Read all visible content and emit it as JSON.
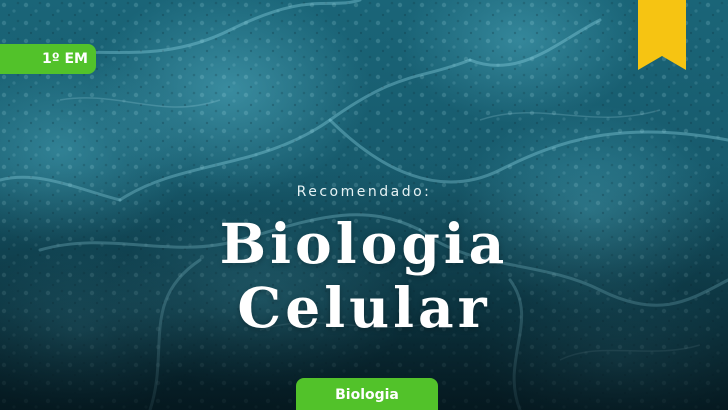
{
  "card": {
    "grade_badge": "1º EM",
    "eyebrow": "Recomendado:",
    "title_line1": "Biologia",
    "title_line2": "Celular",
    "subject_badge": "Biologia"
  },
  "colors": {
    "accent_green": "#52c22a",
    "bookmark_yellow": "#f6c412",
    "background_teal": "#175a6c"
  },
  "icons": {
    "bookmark": "bookmark-icon"
  }
}
